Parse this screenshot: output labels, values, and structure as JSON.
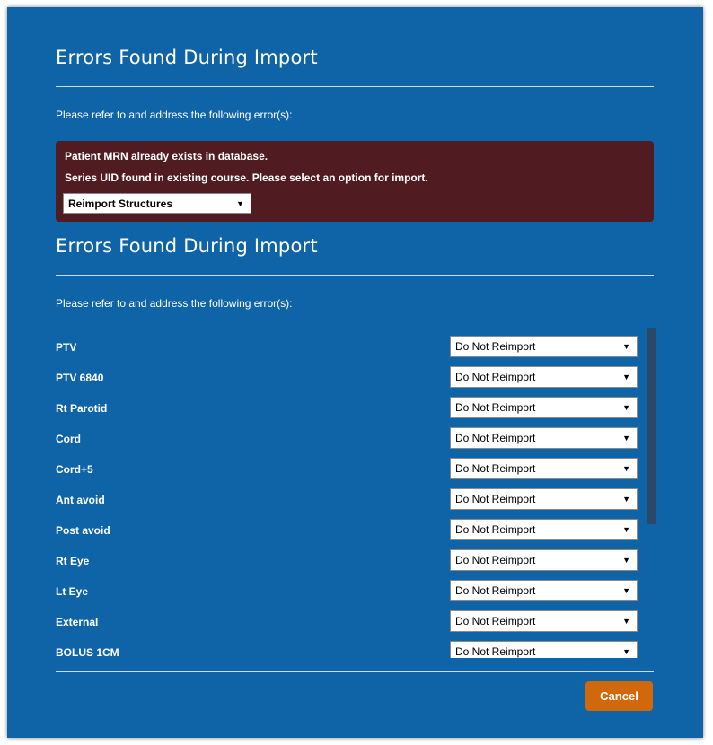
{
  "dialog": {
    "section1": {
      "title": "Errors Found During Import",
      "intro": "Please refer to and address the following error(s):",
      "errors": [
        "Patient MRN already exists in database.",
        "Series UID found in existing course. Please select an option for import."
      ],
      "select_value": "Reimport Structures"
    },
    "section2": {
      "title": "Errors Found During Import",
      "intro": "Please refer to and address the following error(s):",
      "structures": [
        {
          "label": "PTV",
          "value": "Do Not Reimport"
        },
        {
          "label": "PTV 6840",
          "value": "Do Not Reimport"
        },
        {
          "label": "Rt Parotid",
          "value": "Do Not Reimport"
        },
        {
          "label": "Cord",
          "value": "Do Not Reimport"
        },
        {
          "label": "Cord+5",
          "value": "Do Not Reimport"
        },
        {
          "label": "Ant avoid",
          "value": "Do Not Reimport"
        },
        {
          "label": "Post avoid",
          "value": "Do Not Reimport"
        },
        {
          "label": "Rt Eye",
          "value": "Do Not Reimport"
        },
        {
          "label": "Lt Eye",
          "value": "Do Not Reimport"
        },
        {
          "label": "External",
          "value": "Do Not Reimport"
        },
        {
          "label": "BOLUS 1CM",
          "value": "Do Not Reimport"
        }
      ]
    },
    "cancel_label": "Cancel",
    "colors": {
      "dialog_bg": "#0f64a8",
      "error_bg": "#501c22",
      "cancel_bg": "#d2680c"
    },
    "icons": {
      "dropdown_arrow": "▼"
    }
  }
}
